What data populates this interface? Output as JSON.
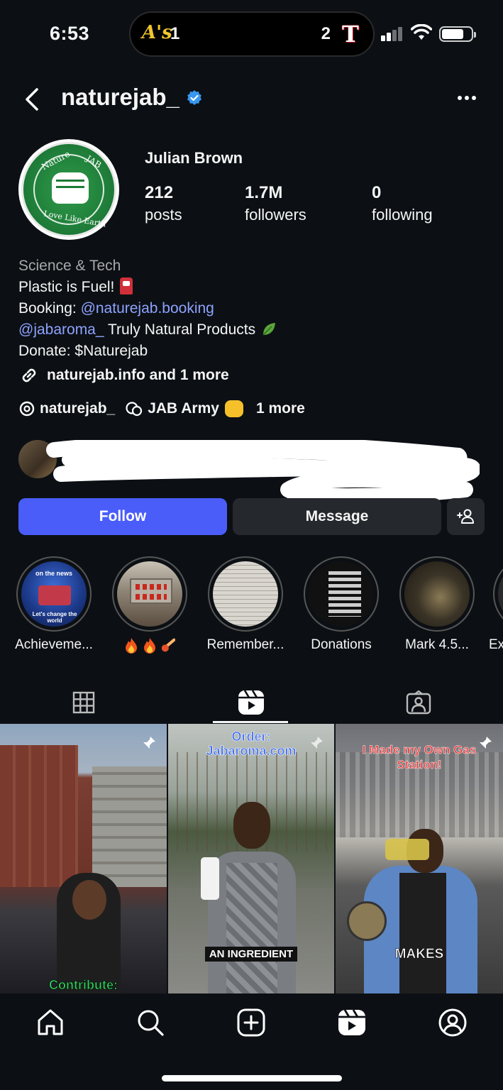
{
  "status_bar": {
    "time": "6:53",
    "left_team": "A's",
    "left_score": "1",
    "right_score": "2",
    "right_team": "T"
  },
  "header": {
    "username": "naturejab_"
  },
  "avatar_logo": {
    "top_left": "Nature",
    "top_right": "JAB",
    "bottom": "Love Like Earth"
  },
  "profile": {
    "full_name": "Julian Brown",
    "stats": [
      {
        "value": "212",
        "label": "posts"
      },
      {
        "value": "1.7M",
        "label": "followers"
      },
      {
        "value": "0",
        "label": "following"
      }
    ]
  },
  "bio": {
    "category": "Science & Tech",
    "line1": "Plastic is Fuel!",
    "booking_prefix": "Booking: ",
    "booking_link": "@naturejab.booking",
    "line3_link": "@jabaroma_",
    "line3_text": " Truly Natural Products",
    "donate": "Donate: $Naturejab",
    "links": "naturejab.info and 1 more",
    "threads_handle": "naturejab_",
    "channel": "JAB Army",
    "more": "1 more"
  },
  "actions": {
    "follow": "Follow",
    "message": "Message"
  },
  "highlights": [
    {
      "label": "Achieveme..."
    },
    {
      "label": ""
    },
    {
      "label": "Remember..."
    },
    {
      "label": "Donations"
    },
    {
      "label": "Mark 4.5..."
    },
    {
      "label": "Ex"
    }
  ],
  "highlight_overlays": {
    "h1_top": "on the news",
    "h1_bottom": "Let's change the world"
  },
  "reels": [
    {
      "overlay_bottom": "Contribute:"
    },
    {
      "overlay_top": "Order: Jabaroma.com",
      "overlay_bottom": "AN INGREDIENT"
    },
    {
      "overlay_top": "I Made my Own Gas Station!",
      "overlay_bottom": "MAKES"
    }
  ],
  "colors": {
    "background": "#0c1014",
    "follow_button": "#4a5df9",
    "link": "#8ea2ff",
    "verified": "#3897f0"
  }
}
